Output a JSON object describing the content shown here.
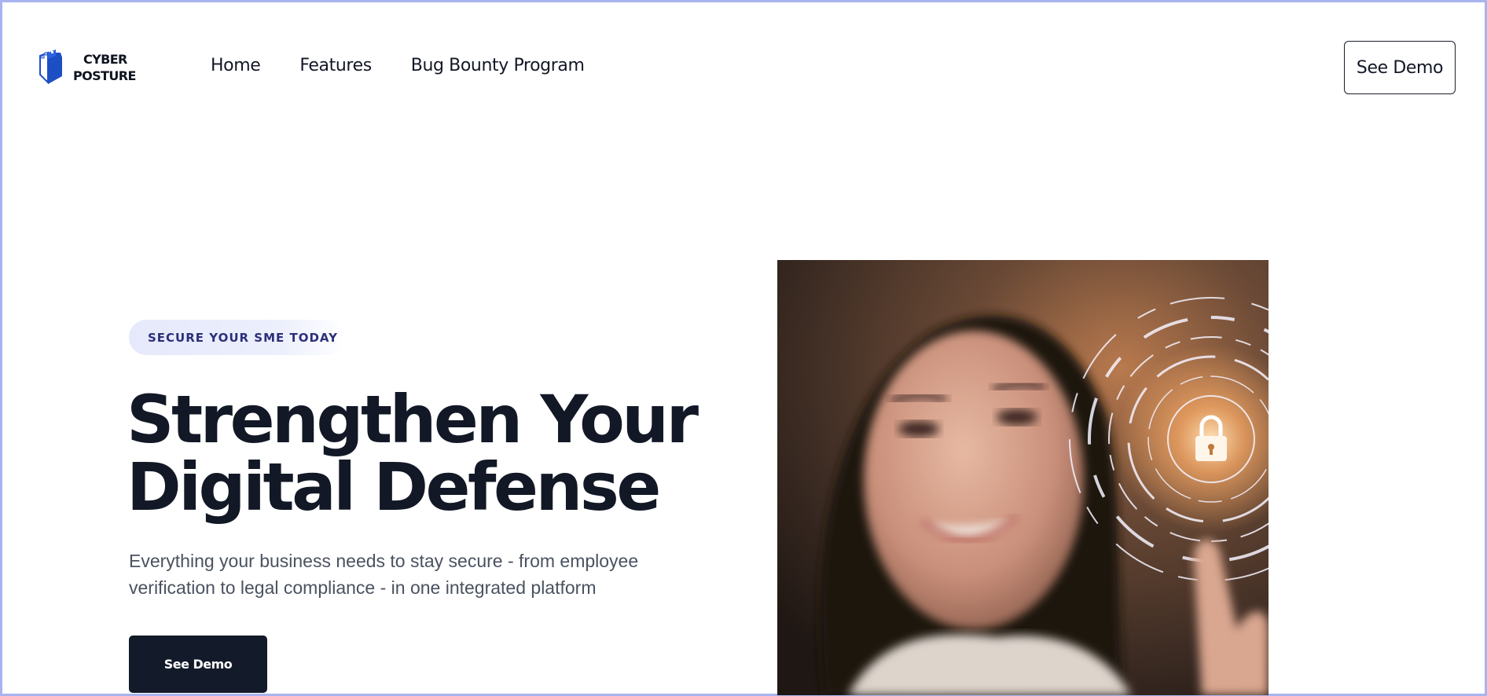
{
  "brand": {
    "name_line1": "CYBER",
    "name_line2": "POSTURE",
    "logo_icon": "shield-castle-icon",
    "accent_color": "#1d4fc4"
  },
  "nav": {
    "links": [
      "Home",
      "Features",
      "Bug Bounty Program"
    ],
    "cta_label": "See Demo"
  },
  "hero": {
    "badge": "SECURE YOUR SME TODAY",
    "headline_line1": "Strengthen Your",
    "headline_line2": "Digital Defense",
    "subtitle_line1": "Everything your business needs to stay secure - from employee",
    "subtitle_line2": "verification to legal compliance - in one integrated platform",
    "cta_label": "See Demo",
    "image_description_icon": "padlock-icon"
  },
  "colors": {
    "dark": "#121826",
    "button_dark": "#131a29",
    "badge_bg": "#e6e9fb",
    "badge_text": "#2b2f7a",
    "subtitle": "#4a5260"
  }
}
